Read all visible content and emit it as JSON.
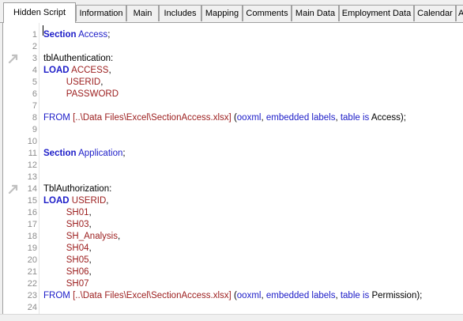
{
  "tabs": [
    {
      "label": "Hidden Script"
    },
    {
      "label": "Information"
    },
    {
      "label": "Main"
    },
    {
      "label": "Includes"
    },
    {
      "label": "Mapping"
    },
    {
      "label": "Comments"
    },
    {
      "label": "Main Data"
    },
    {
      "label": "Employment Data"
    },
    {
      "label": "Calendar"
    },
    {
      "label": "A"
    }
  ],
  "active_tab": "Hidden Script",
  "colors": {
    "keyword": "#1c1cc8",
    "field": "#9b1c1c",
    "line_number": "#8c8c8c"
  },
  "script": {
    "lines": [
      {
        "n": "1",
        "parts": [
          {
            "t": "Section",
            "c": "kw"
          },
          {
            "t": " ",
            "c": "pl"
          },
          {
            "t": "Access",
            "c": "id"
          },
          {
            "t": ";",
            "c": "pl"
          }
        ]
      },
      {
        "n": "2",
        "parts": []
      },
      {
        "n": "3",
        "bookmark": true,
        "parts": [
          {
            "t": "tblAuthentication:",
            "c": "pl"
          }
        ]
      },
      {
        "n": "4",
        "parts": [
          {
            "t": "LOAD",
            "c": "kw"
          },
          {
            "t": " ",
            "c": "pl"
          },
          {
            "t": "ACCESS",
            "c": "fld"
          },
          {
            "t": ",",
            "c": "pl"
          }
        ]
      },
      {
        "n": "5",
        "parts": [
          {
            "t": "         ",
            "c": "pl"
          },
          {
            "t": "USERID",
            "c": "fld"
          },
          {
            "t": ",",
            "c": "pl"
          }
        ]
      },
      {
        "n": "6",
        "parts": [
          {
            "t": "         ",
            "c": "pl"
          },
          {
            "t": "PASSWORD",
            "c": "fld"
          }
        ]
      },
      {
        "n": "7",
        "parts": []
      },
      {
        "n": "8",
        "parts": [
          {
            "t": "FROM",
            "c": "id"
          },
          {
            "t": " ",
            "c": "pl"
          },
          {
            "t": "[..\\Data Files\\Excel\\SectionAccess.xlsx]",
            "c": "fld"
          },
          {
            "t": " (",
            "c": "pl"
          },
          {
            "t": "ooxml",
            "c": "id"
          },
          {
            "t": ", ",
            "c": "pl"
          },
          {
            "t": "embedded labels",
            "c": "id"
          },
          {
            "t": ", ",
            "c": "pl"
          },
          {
            "t": "table is",
            "c": "id"
          },
          {
            "t": " Access);",
            "c": "pl"
          }
        ]
      },
      {
        "n": "9",
        "parts": []
      },
      {
        "n": "10",
        "parts": []
      },
      {
        "n": "11",
        "parts": [
          {
            "t": "Section",
            "c": "kw"
          },
          {
            "t": " ",
            "c": "pl"
          },
          {
            "t": "Application",
            "c": "id"
          },
          {
            "t": ";",
            "c": "pl"
          }
        ]
      },
      {
        "n": "12",
        "parts": []
      },
      {
        "n": "13",
        "parts": []
      },
      {
        "n": "14",
        "bookmark": true,
        "parts": [
          {
            "t": "TblAuthorization:",
            "c": "pl"
          }
        ]
      },
      {
        "n": "15",
        "parts": [
          {
            "t": "LOAD",
            "c": "kw"
          },
          {
            "t": " ",
            "c": "pl"
          },
          {
            "t": "USERID",
            "c": "fld"
          },
          {
            "t": ",",
            "c": "pl"
          }
        ]
      },
      {
        "n": "16",
        "parts": [
          {
            "t": "         ",
            "c": "pl"
          },
          {
            "t": "SH01",
            "c": "fld"
          },
          {
            "t": ",",
            "c": "pl"
          }
        ]
      },
      {
        "n": "17",
        "parts": [
          {
            "t": "         ",
            "c": "pl"
          },
          {
            "t": "SH03",
            "c": "fld"
          },
          {
            "t": ",",
            "c": "pl"
          }
        ]
      },
      {
        "n": "18",
        "parts": [
          {
            "t": "         ",
            "c": "pl"
          },
          {
            "t": "SH_Analysis",
            "c": "fld"
          },
          {
            "t": ",",
            "c": "pl"
          }
        ]
      },
      {
        "n": "19",
        "parts": [
          {
            "t": "         ",
            "c": "pl"
          },
          {
            "t": "SH04",
            "c": "fld"
          },
          {
            "t": ",",
            "c": "pl"
          }
        ]
      },
      {
        "n": "20",
        "parts": [
          {
            "t": "         ",
            "c": "pl"
          },
          {
            "t": "SH05",
            "c": "fld"
          },
          {
            "t": ",",
            "c": "pl"
          }
        ]
      },
      {
        "n": "21",
        "parts": [
          {
            "t": "         ",
            "c": "pl"
          },
          {
            "t": "SH06",
            "c": "fld"
          },
          {
            "t": ",",
            "c": "pl"
          }
        ]
      },
      {
        "n": "22",
        "parts": [
          {
            "t": "         ",
            "c": "pl"
          },
          {
            "t": "SH07",
            "c": "fld"
          }
        ]
      },
      {
        "n": "23",
        "parts": [
          {
            "t": "FROM",
            "c": "id"
          },
          {
            "t": " ",
            "c": "pl"
          },
          {
            "t": "[..\\Data Files\\Excel\\SectionAccess.xlsx]",
            "c": "fld"
          },
          {
            "t": " (",
            "c": "pl"
          },
          {
            "t": "ooxml",
            "c": "id"
          },
          {
            "t": ", ",
            "c": "pl"
          },
          {
            "t": "embedded labels",
            "c": "id"
          },
          {
            "t": ", ",
            "c": "pl"
          },
          {
            "t": "table is",
            "c": "id"
          },
          {
            "t": " Permission);",
            "c": "pl"
          }
        ]
      },
      {
        "n": "24",
        "parts": []
      }
    ]
  }
}
